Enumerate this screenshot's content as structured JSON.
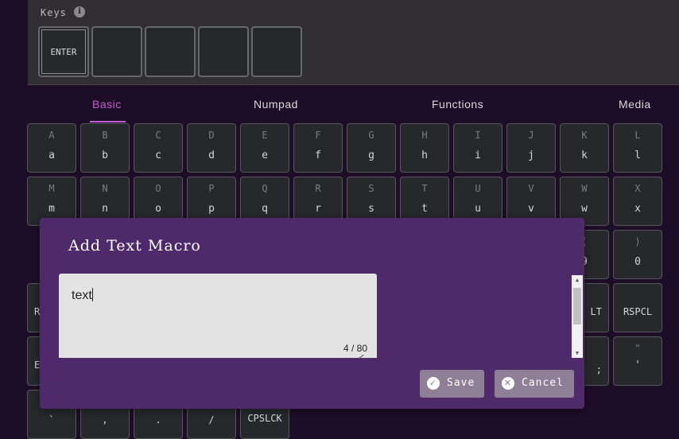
{
  "keys_panel": {
    "title": "Keys",
    "info_icon": "info-icon",
    "slots": [
      "ENTER",
      "",
      "",
      "",
      ""
    ]
  },
  "tabs": [
    {
      "label": "Basic",
      "active": true
    },
    {
      "label": "Numpad",
      "active": false
    },
    {
      "label": "Functions",
      "active": false
    },
    {
      "label": "Media",
      "active": false
    }
  ],
  "keyboard": {
    "row1": [
      {
        "shift": "A",
        "main": "a"
      },
      {
        "shift": "B",
        "main": "b"
      },
      {
        "shift": "C",
        "main": "c"
      },
      {
        "shift": "D",
        "main": "d"
      },
      {
        "shift": "E",
        "main": "e"
      },
      {
        "shift": "F",
        "main": "f"
      },
      {
        "shift": "G",
        "main": "g"
      },
      {
        "shift": "H",
        "main": "h"
      },
      {
        "shift": "I",
        "main": "i"
      },
      {
        "shift": "J",
        "main": "j"
      },
      {
        "shift": "K",
        "main": "k"
      },
      {
        "shift": "L",
        "main": "l"
      }
    ],
    "row2": [
      {
        "shift": "M",
        "main": "m"
      },
      {
        "shift": "N",
        "main": "n"
      },
      {
        "shift": "O",
        "main": "o"
      },
      {
        "shift": "P",
        "main": "p"
      },
      {
        "shift": "Q",
        "main": "q"
      },
      {
        "shift": "R",
        "main": "r"
      },
      {
        "shift": "S",
        "main": "s"
      },
      {
        "shift": "T",
        "main": "t"
      },
      {
        "shift": "U",
        "main": "u"
      },
      {
        "shift": "V",
        "main": "v"
      },
      {
        "shift": "W",
        "main": "w"
      },
      {
        "shift": "X",
        "main": "x"
      }
    ],
    "row3_right": [
      {
        "shift": "(",
        "main": "9"
      },
      {
        "shift": ")",
        "main": "0"
      }
    ],
    "row4_left": "R",
    "row4_right": [
      "LT",
      "RSPCL"
    ],
    "row5_left": "E",
    "row5_right": [
      {
        "shift": "",
        "main": ";"
      },
      {
        "shift": "\"",
        "main": "'"
      }
    ],
    "row6": [
      "`",
      ",",
      ".",
      "/",
      "CPSLCK"
    ]
  },
  "modal": {
    "title": "Add Text Macro",
    "textarea_value": "text",
    "char_count": "4 / 80",
    "save_label": "Save",
    "cancel_label": "Cancel",
    "save_icon": "check-circle-icon",
    "cancel_icon": "close-circle-icon"
  },
  "colors": {
    "accent": "#c35fd1",
    "modal_bg": "#4e2a6b",
    "page_bg": "#1e0d26"
  }
}
